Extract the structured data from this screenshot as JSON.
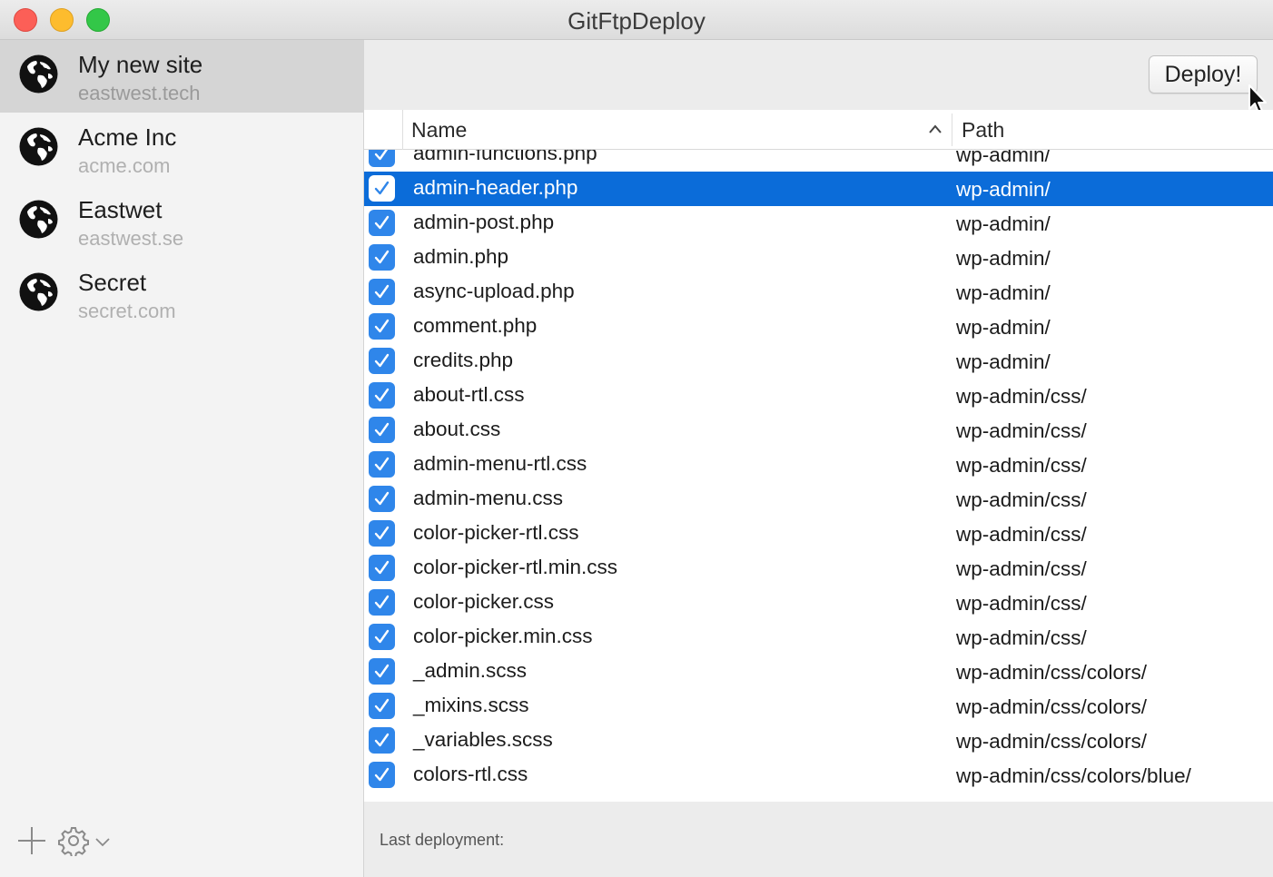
{
  "window": {
    "title": "GitFtpDeploy"
  },
  "sidebar": {
    "sites": [
      {
        "name": "My new site",
        "domain": "eastwest.tech",
        "selected": true,
        "icon": "globe-icon"
      },
      {
        "name": "Acme Inc",
        "domain": "acme.com",
        "selected": false,
        "icon": "globe-icon"
      },
      {
        "name": "Eastwet",
        "domain": "eastwest.se",
        "selected": false,
        "icon": "globe-icon"
      },
      {
        "name": "Secret",
        "domain": "secret.com",
        "selected": false,
        "icon": "globe-icon"
      }
    ],
    "footer": {
      "add_icon": "plus-icon",
      "settings_icon": "gear-icon",
      "dropdown_icon": "chevron-down-icon"
    }
  },
  "toolbar": {
    "deploy_label": "Deploy!"
  },
  "table": {
    "columns": {
      "name": "Name",
      "path": "Path"
    },
    "sort": {
      "column": "Name",
      "direction": "ascending"
    },
    "rows": [
      {
        "name": "admin-functions.php",
        "path": "wp-admin/",
        "checked": true,
        "selected": false
      },
      {
        "name": "admin-header.php",
        "path": "wp-admin/",
        "checked": true,
        "selected": true
      },
      {
        "name": "admin-post.php",
        "path": "wp-admin/",
        "checked": true,
        "selected": false
      },
      {
        "name": "admin.php",
        "path": "wp-admin/",
        "checked": true,
        "selected": false
      },
      {
        "name": "async-upload.php",
        "path": "wp-admin/",
        "checked": true,
        "selected": false
      },
      {
        "name": "comment.php",
        "path": "wp-admin/",
        "checked": true,
        "selected": false
      },
      {
        "name": "credits.php",
        "path": "wp-admin/",
        "checked": true,
        "selected": false
      },
      {
        "name": "about-rtl.css",
        "path": "wp-admin/css/",
        "checked": true,
        "selected": false
      },
      {
        "name": "about.css",
        "path": "wp-admin/css/",
        "checked": true,
        "selected": false
      },
      {
        "name": "admin-menu-rtl.css",
        "path": "wp-admin/css/",
        "checked": true,
        "selected": false
      },
      {
        "name": "admin-menu.css",
        "path": "wp-admin/css/",
        "checked": true,
        "selected": false
      },
      {
        "name": "color-picker-rtl.css",
        "path": "wp-admin/css/",
        "checked": true,
        "selected": false
      },
      {
        "name": "color-picker-rtl.min.css",
        "path": "wp-admin/css/",
        "checked": true,
        "selected": false
      },
      {
        "name": "color-picker.css",
        "path": "wp-admin/css/",
        "checked": true,
        "selected": false
      },
      {
        "name": "color-picker.min.css",
        "path": "wp-admin/css/",
        "checked": true,
        "selected": false
      },
      {
        "name": "_admin.scss",
        "path": "wp-admin/css/colors/",
        "checked": true,
        "selected": false
      },
      {
        "name": "_mixins.scss",
        "path": "wp-admin/css/colors/",
        "checked": true,
        "selected": false
      },
      {
        "name": "_variables.scss",
        "path": "wp-admin/css/colors/",
        "checked": true,
        "selected": false
      },
      {
        "name": "colors-rtl.css",
        "path": "wp-admin/css/colors/blue/",
        "checked": true,
        "selected": false
      }
    ]
  },
  "status": {
    "last_deployment_label": "Last deployment:"
  },
  "colors": {
    "selection": "#0b6cd9",
    "checkbox": "#2f86ea",
    "sidebar_selected": "#d5d5d5"
  }
}
